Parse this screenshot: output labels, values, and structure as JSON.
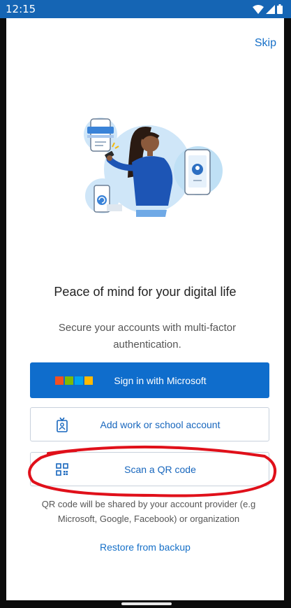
{
  "status_bar": {
    "time": "12:15"
  },
  "header": {
    "skip_label": "Skip"
  },
  "hero": {
    "headline": "Peace of mind for your digital life",
    "subtext": "Secure your accounts with multi-factor authentication."
  },
  "actions": {
    "sign_in_label": "Sign in with Microsoft",
    "add_account_label": "Add work or school account",
    "scan_qr_label": "Scan a QR code"
  },
  "qr_note": "QR code will be shared by your account provider (e.g Microsoft, Google, Facebook) or organization",
  "restore_label": "Restore from backup",
  "colors": {
    "status_bar": "#1565b4",
    "primary": "#0f6dcc",
    "link": "#1670c8",
    "annotation": "#e0101a"
  },
  "icons": [
    "wifi-icon",
    "signal-icon",
    "battery-icon",
    "microsoft-logo-icon",
    "badge-icon",
    "qr-code-icon"
  ]
}
